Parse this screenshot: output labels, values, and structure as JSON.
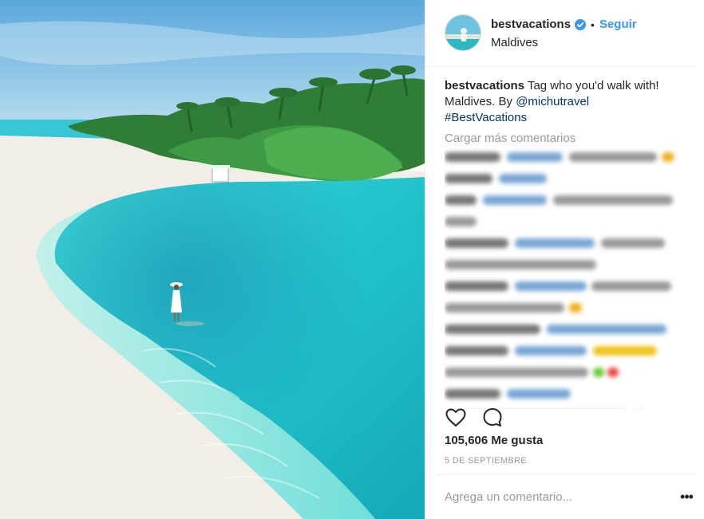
{
  "post": {
    "username": "bestvacations",
    "separator": "•",
    "follow_label": "Seguir",
    "location": "Maldives",
    "caption_user": "bestvacations",
    "caption_text": " Tag who you'd walk with! Maldives. By ",
    "caption_mention": "@michutravel",
    "caption_hashtag": "#BestVacations",
    "load_more": "Cargar más comentarios",
    "likes": "105,606 Me gusta",
    "date": "5 DE SEPTIEMBRE",
    "comment_placeholder": "Agrega un comentario...",
    "more_options": "•••"
  },
  "icons": {
    "verified": "verified-badge-icon",
    "like": "heart-icon",
    "comment": "comment-bubble-icon",
    "options": "more-options-icon"
  },
  "colors": {
    "link_blue": "#3897f0",
    "text": "#262626",
    "muted": "#999999",
    "border": "#efefef"
  }
}
